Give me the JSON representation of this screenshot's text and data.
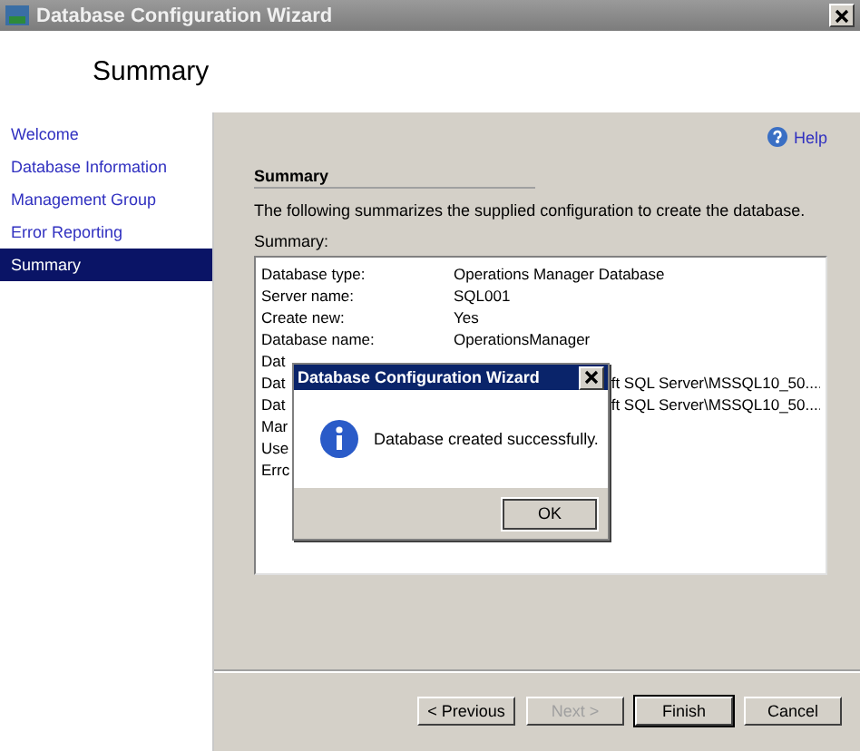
{
  "window": {
    "title": "Database Configuration Wizard"
  },
  "header": {
    "title": "Summary"
  },
  "sidebar": {
    "items": [
      {
        "label": "Welcome",
        "selected": false
      },
      {
        "label": "Database Information",
        "selected": false
      },
      {
        "label": "Management Group",
        "selected": false
      },
      {
        "label": "Error Reporting",
        "selected": false
      },
      {
        "label": "Summary",
        "selected": true
      }
    ]
  },
  "help": "Help",
  "section_title": "Summary",
  "description": "The following summarizes the supplied configuration to create the database.",
  "summary": {
    "label": "Summary:",
    "rows": [
      {
        "kind": "full",
        "label": "Database type:",
        "value": "Operations Manager Database"
      },
      {
        "kind": "full",
        "label": "Server name:",
        "value": "SQL001"
      },
      {
        "kind": "full",
        "label": "Create new:",
        "value": "Yes"
      },
      {
        "kind": "full",
        "label": "Database name:",
        "value": "OperationsManager"
      },
      {
        "kind": "covered",
        "label": "Dat"
      },
      {
        "kind": "covered",
        "label": "Dat",
        "value": "ft SQL Server\\MSSQL10_50...."
      },
      {
        "kind": "covered",
        "label": "Dat",
        "value": "ft SQL Server\\MSSQL10_50...."
      },
      {
        "kind": "covered",
        "label": "Mar"
      },
      {
        "kind": "covered",
        "label": "Use"
      },
      {
        "kind": "covered",
        "label": "Errc"
      }
    ]
  },
  "buttons": [
    {
      "label": "< Previous",
      "disabled": false,
      "default": false
    },
    {
      "label": "Next >",
      "disabled": true,
      "default": false
    },
    {
      "label": "Finish",
      "disabled": false,
      "default": true
    },
    {
      "label": "Cancel",
      "disabled": false,
      "default": false
    }
  ],
  "dialog": {
    "title": "Database Configuration Wizard",
    "message": "Database created successfully.",
    "button": "OK"
  }
}
